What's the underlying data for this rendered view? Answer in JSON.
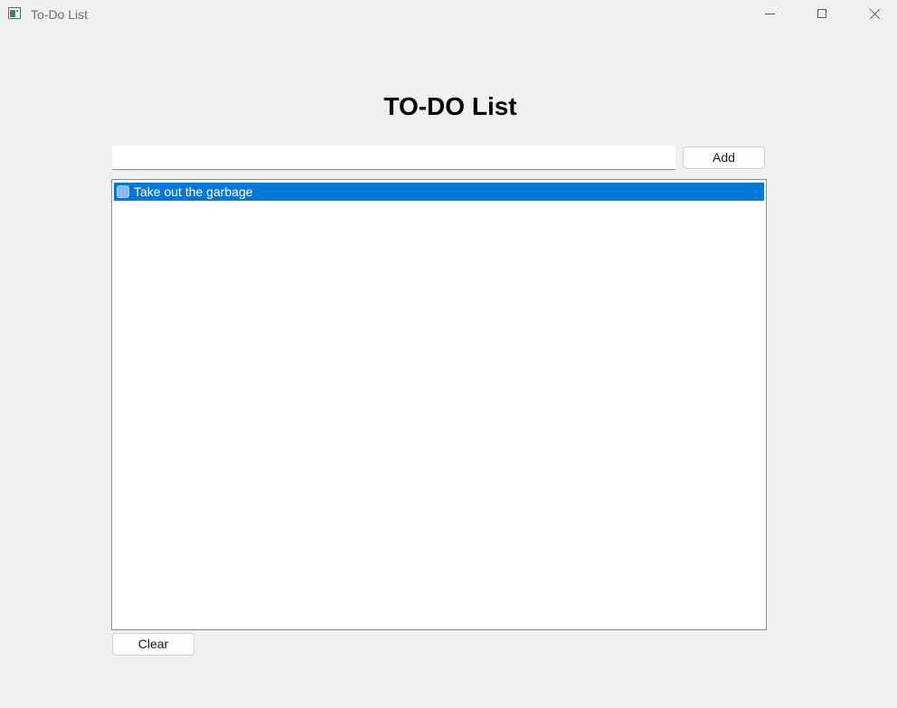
{
  "window": {
    "title": "To-Do List",
    "icon": "app-window-icon"
  },
  "caption_buttons": {
    "minimize": "minimize-icon",
    "maximize": "maximize-icon",
    "close": "close-icon"
  },
  "main": {
    "heading": "TO-DO List",
    "input": {
      "value": "",
      "placeholder": ""
    },
    "add_label": "Add",
    "clear_label": "Clear",
    "tasks": [
      {
        "label": "Take out the garbage",
        "checked": false,
        "selected": true
      }
    ]
  },
  "colors": {
    "selection": "#0078d7",
    "background": "#f0f0f0"
  }
}
